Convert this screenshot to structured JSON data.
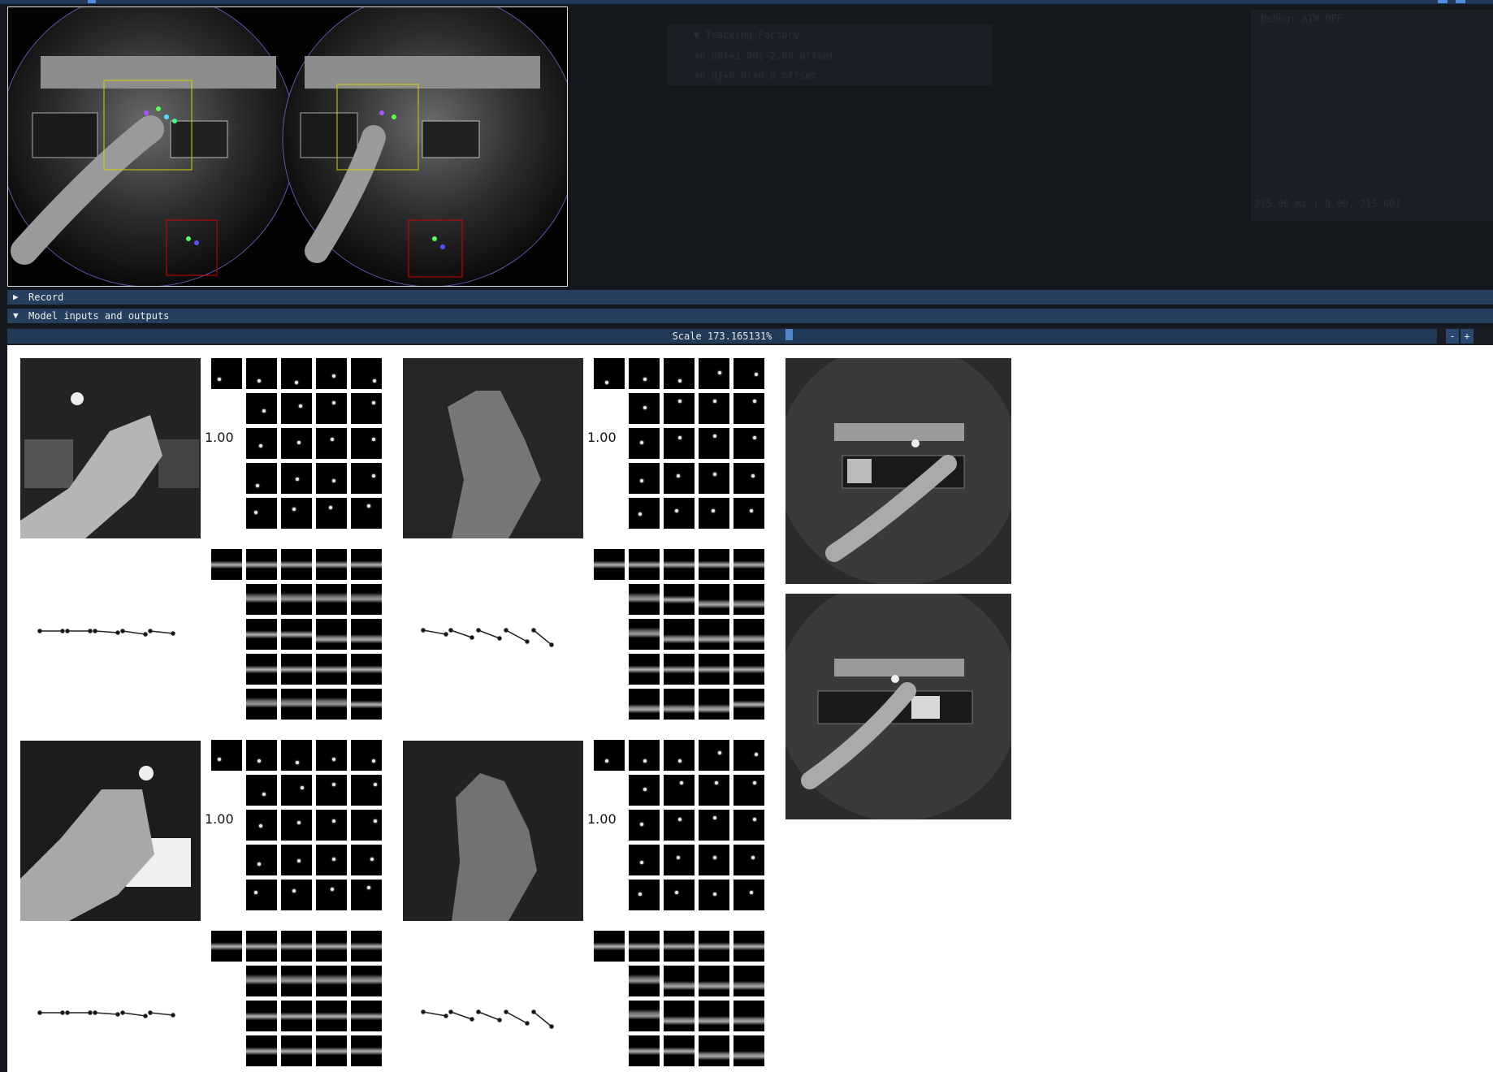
{
  "window": {
    "accent_color": "#4f8cd6",
    "header_color": "#263f5e",
    "background_color": "#14171c"
  },
  "background_windows": {
    "tracking_header": "▼ Tracking Factory",
    "tracking_line_1": "+0.00|+1.00|-2.00 offset",
    "tracking_line_2": "+0.0|+0.0|+0.0 offset",
    "debug_title": "Debug: ATW OFF",
    "timing_readout": "215.00 ms | 0.00, 215.00]"
  },
  "camera_view": {
    "description_icon": "stereo-camera-feed",
    "left_label": "",
    "right_label": ""
  },
  "headers": {
    "record": {
      "arrow": "▶",
      "label": "Record"
    },
    "model_io": {
      "arrow": "▼",
      "label": "Model inputs and outputs"
    }
  },
  "scale_control": {
    "label": "Scale 173.165131%",
    "value_percent": 173.165131,
    "minus": "-",
    "plus": "+"
  },
  "viewer": {
    "confidence_labels": [
      "1.00",
      "1.00",
      "1.00",
      "1.00"
    ]
  }
}
